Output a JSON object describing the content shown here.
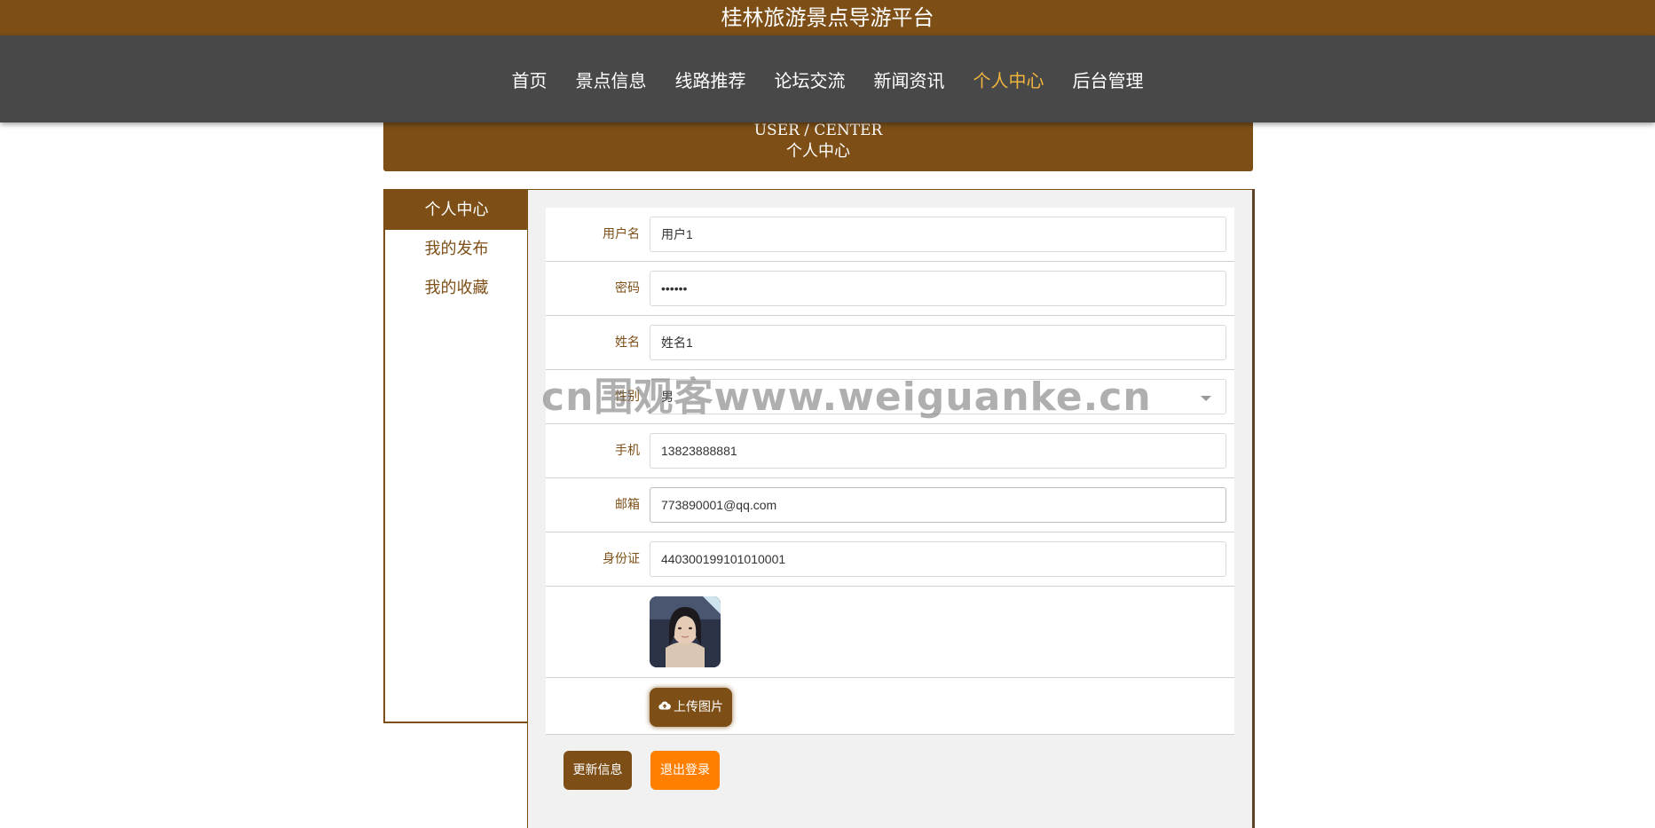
{
  "site": {
    "title": "桂林旅游景点导游平台"
  },
  "nav": {
    "items": [
      {
        "label": "首页"
      },
      {
        "label": "景点信息"
      },
      {
        "label": "线路推荐"
      },
      {
        "label": "论坛交流"
      },
      {
        "label": "新闻资讯"
      },
      {
        "label": "个人中心",
        "active": true
      },
      {
        "label": "后台管理"
      }
    ]
  },
  "banner": {
    "en": "USER / CENTER",
    "cn": "个人中心"
  },
  "sidebar": {
    "items": [
      {
        "label": "个人中心",
        "active": true
      },
      {
        "label": "我的发布"
      },
      {
        "label": "我的收藏"
      }
    ]
  },
  "form": {
    "username": {
      "label": "用户名",
      "value": "用户1"
    },
    "password": {
      "label": "密码",
      "value": "••••••"
    },
    "name": {
      "label": "姓名",
      "value": "姓名1"
    },
    "gender": {
      "label": "性别",
      "value": "男"
    },
    "phone": {
      "label": "手机",
      "value": "13823888881"
    },
    "email": {
      "label": "邮箱",
      "value": "773890001@qq.com"
    },
    "idcard": {
      "label": "身份证",
      "value": "440300199101010001"
    },
    "upload_label": "上传图片"
  },
  "actions": {
    "update": "更新信息",
    "logout": "退出登录"
  },
  "watermark": "cn围观客www.weiguanke.cn",
  "colors": {
    "brand": "#7d4f17",
    "nav_bg": "#484848",
    "active_nav": "#f1b53c",
    "logout": "#ff7f00"
  }
}
